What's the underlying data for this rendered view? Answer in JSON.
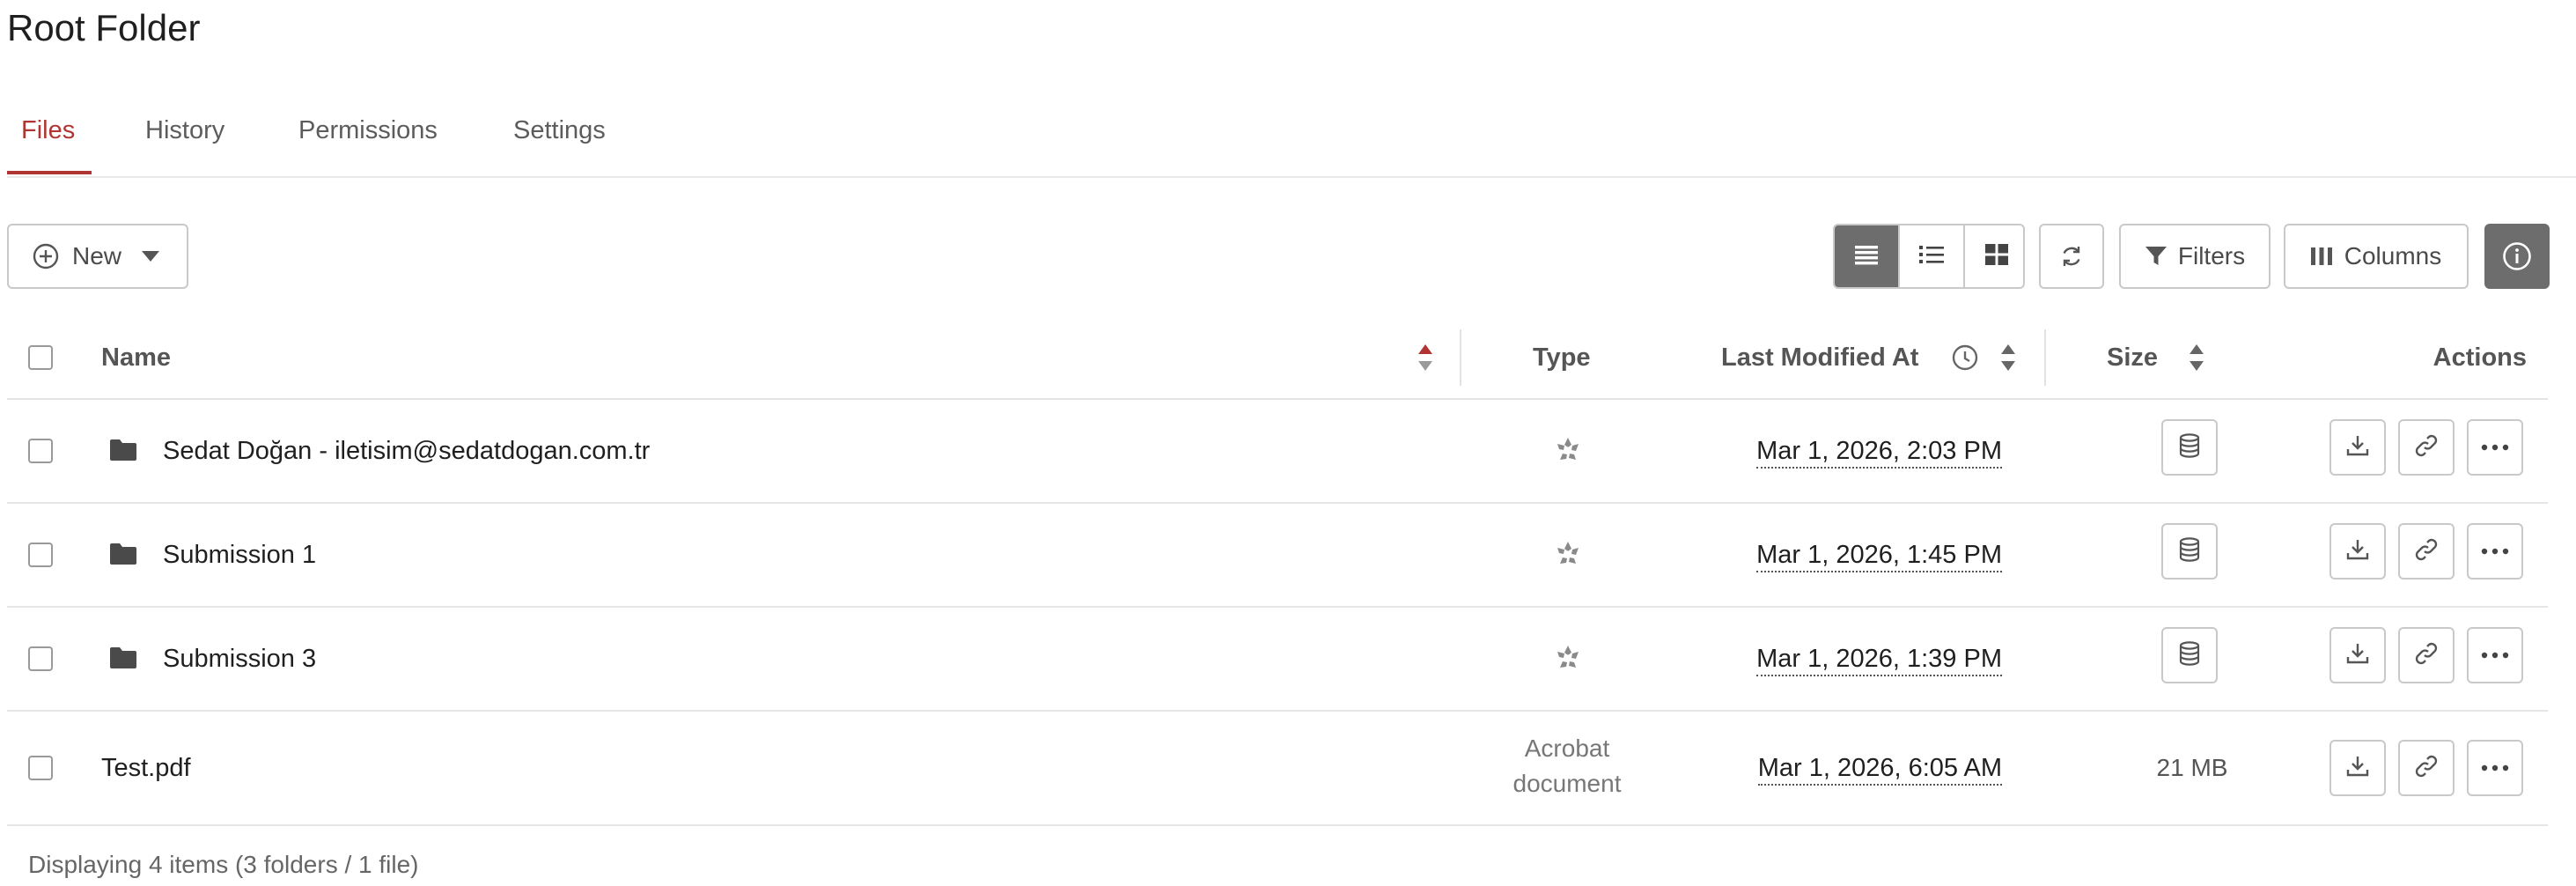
{
  "page": {
    "title": "Root Folder"
  },
  "tabs": [
    {
      "label": "Files",
      "active": true
    },
    {
      "label": "History",
      "active": false
    },
    {
      "label": "Permissions",
      "active": false
    },
    {
      "label": "Settings",
      "active": false
    }
  ],
  "toolbar": {
    "new_label": "New",
    "filters_label": "Filters",
    "columns_label": "Columns",
    "view_modes": [
      "compact-list",
      "detail-list",
      "grid"
    ],
    "active_view": "compact-list"
  },
  "table": {
    "columns": {
      "name": "Name",
      "type": "Type",
      "modified": "Last Modified At",
      "size": "Size",
      "actions": "Actions"
    },
    "rows": [
      {
        "kind": "folder",
        "name": "Sedat Doğan - iletisim@sedatdogan.com.tr",
        "type_icon": "shared-folder-icon",
        "modified": "Mar 1, 2026, 2:03 PM",
        "size_icon": "database-icon"
      },
      {
        "kind": "folder",
        "name": "Submission 1",
        "type_icon": "shared-folder-icon",
        "modified": "Mar 1, 2026, 1:45 PM",
        "size_icon": "database-icon"
      },
      {
        "kind": "folder",
        "name": "Submission 3",
        "type_icon": "shared-folder-icon",
        "modified": "Mar 1, 2026, 1:39 PM",
        "size_icon": "database-icon"
      },
      {
        "kind": "file",
        "name": "Test.pdf",
        "type_line1": "Acrobat",
        "type_line2": "document",
        "modified": "Mar 1, 2026, 6:05 AM",
        "size": "21 MB"
      }
    ]
  },
  "footer": {
    "summary": "Displaying 4 items (3 folders / 1 file)"
  },
  "colors": {
    "accent": "#b03532",
    "active_segment": "#6d6d6d",
    "border": "#c9c9c9"
  }
}
